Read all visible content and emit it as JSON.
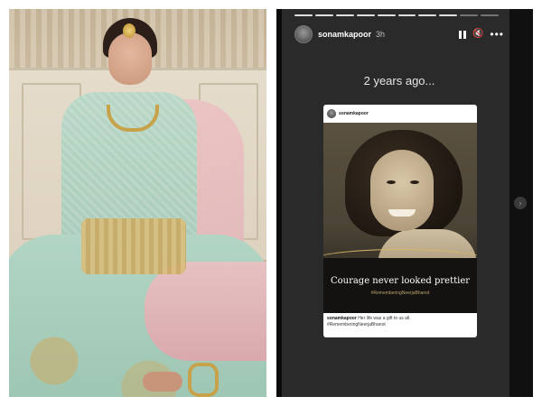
{
  "story": {
    "username": "sonamkapoor",
    "time_ago": "3h",
    "memory_label": "2 years ago...",
    "progress_segments": [
      {
        "state": "done"
      },
      {
        "state": "done"
      },
      {
        "state": "done"
      },
      {
        "state": "done"
      },
      {
        "state": "done"
      },
      {
        "state": "done"
      },
      {
        "state": "done"
      },
      {
        "state": "done"
      },
      {
        "state": "pending"
      },
      {
        "state": "pending"
      }
    ],
    "controls": {
      "pause_icon": "pause-icon",
      "mute_icon": "speaker-muted-icon",
      "mute_glyph": "🔇",
      "more_icon": "more-options-icon",
      "more_glyph": "•••"
    },
    "side_nav_glyph": "›"
  },
  "shared_post": {
    "username": "sonamkapoor",
    "caption_image_text": "Courage never looked prettier",
    "caption_image_tag": "#RememberingNeerjaBhanot",
    "footer_user": "sonamkapoor",
    "footer_text": "Her life was a gift to us all.",
    "footer_hashtag": "#RememberingNeerjaBhanot"
  },
  "colors": {
    "story_bg": "#2a2a2a",
    "gold_accent": "#d8b667"
  }
}
